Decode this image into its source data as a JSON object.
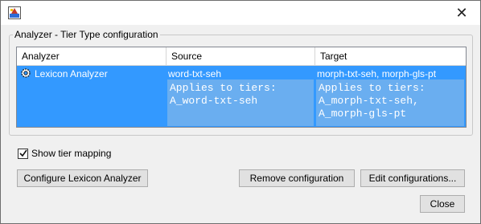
{
  "window": {
    "close_glyph": "✕"
  },
  "group": {
    "title": "Analyzer - Tier Type configuration"
  },
  "table": {
    "columns": [
      "Analyzer",
      "Source",
      "Target"
    ],
    "rows": [
      {
        "analyzer": "Lexicon Analyzer",
        "source": "word-txt-seh",
        "source_applies": "Applies to tiers:\nA_word-txt-seh",
        "target": "morph-txt-seh, morph-gls-pt",
        "target_applies": "Applies to tiers:\nA_morph-txt-seh,\nA_morph-gls-pt"
      }
    ]
  },
  "options": {
    "show_tier_mapping_label": "Show tier mapping",
    "show_tier_mapping_checked": true
  },
  "buttons": {
    "configure": "Configure Lexicon Analyzer",
    "remove": "Remove configuration",
    "edit": "Edit configurations...",
    "close": "Close"
  },
  "icons": {
    "app": "app-icon",
    "analyzer": "gear-icon",
    "close": "close-icon",
    "check": "checkmark-icon"
  },
  "colors": {
    "selection": "#3399ff",
    "applies_bg": "#6aaef0"
  }
}
